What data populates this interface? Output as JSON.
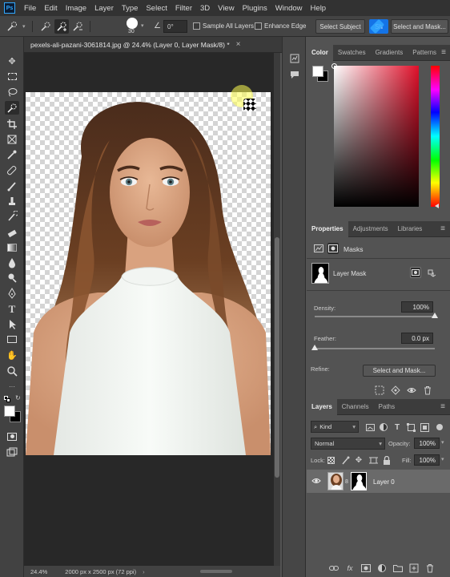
{
  "app": {
    "logo": "Ps",
    "menu": [
      "File",
      "Edit",
      "Image",
      "Layer",
      "Type",
      "Select",
      "Filter",
      "3D",
      "View",
      "Plugins",
      "Window",
      "Help"
    ]
  },
  "options": {
    "brush_size": "30",
    "angle": "0°",
    "sample_all_layers": "Sample All Layers",
    "enhance_edge": "Enhance Edge",
    "select_subject": "Select Subject",
    "share_partial": "Sh",
    "select_and_mask": "Select and Mask..."
  },
  "document": {
    "tab_title": "pexels-ali-pazani-3061814.jpg @ 24.4% (Layer 0, Layer Mask/8) *",
    "close_glyph": "×",
    "zoom": "24.4%",
    "dimensions": "2000 px x 2500 px (72 ppi)"
  },
  "color_panel": {
    "tabs": [
      "Color",
      "Swatches",
      "Gradients",
      "Patterns"
    ]
  },
  "properties_panel": {
    "tabs": [
      "Properties",
      "Adjustments",
      "Libraries"
    ],
    "section": "Masks",
    "mask_name": "Layer Mask",
    "density_label": "Density:",
    "density_value": "100%",
    "density_fraction": 1.0,
    "feather_label": "Feather:",
    "feather_value": "0.0 px",
    "feather_fraction": 0.0,
    "refine_label": "Refine:",
    "select_and_mask": "Select and Mask..."
  },
  "layers_panel": {
    "tabs": [
      "Layers",
      "Channels",
      "Paths"
    ],
    "kind": "Kind",
    "blend_mode": "Normal",
    "opacity_label": "Opacity:",
    "opacity_value": "100%",
    "lock_label": "Lock:",
    "fill_label": "Fill:",
    "fill_value": "100%",
    "layers": [
      {
        "name": "Layer 0",
        "visible": true
      }
    ]
  },
  "colors": {
    "accent": "#31a8ff",
    "panel_bg": "#535353",
    "canvas_bg": "#282828"
  }
}
